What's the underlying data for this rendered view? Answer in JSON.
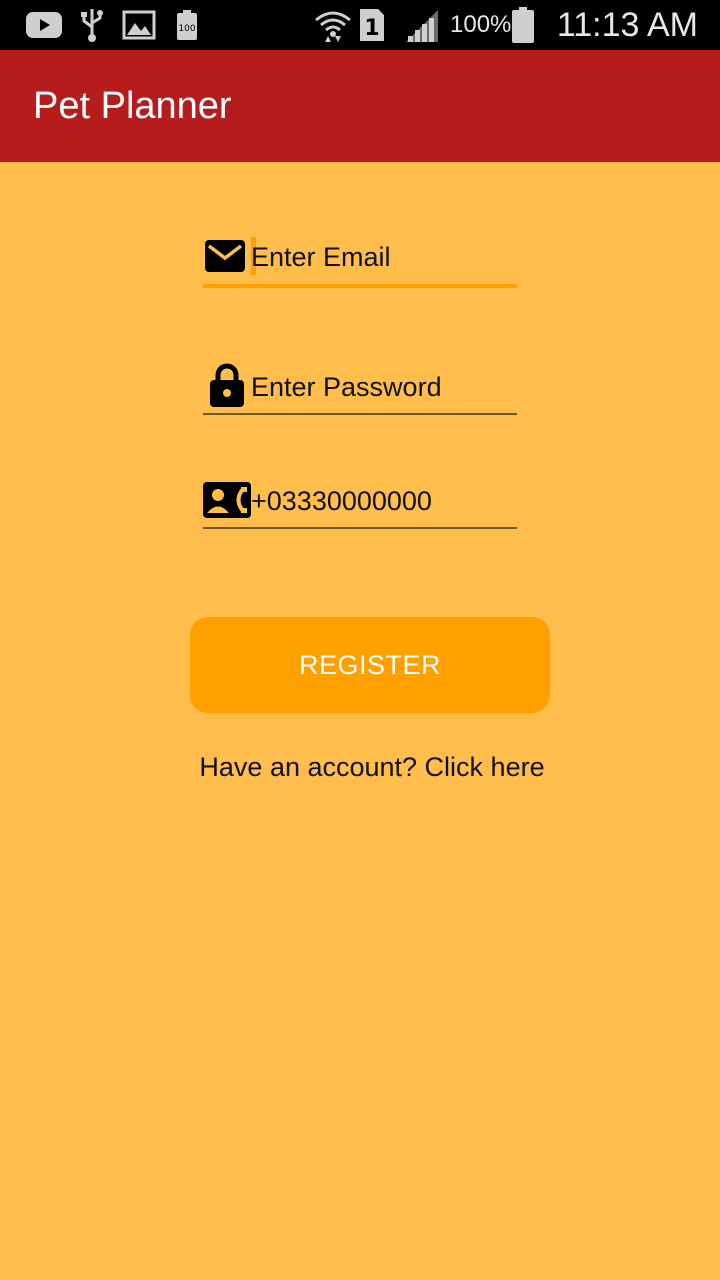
{
  "status_bar": {
    "time": "11:13 AM",
    "battery_percent": "100%",
    "sim_slot": "1",
    "notification_battery_label": "100",
    "icons": [
      "youtube-icon",
      "usb-icon",
      "gallery-icon",
      "battery-notify-icon",
      "wifi-icon",
      "sim-icon",
      "signal-icon",
      "battery-icon"
    ]
  },
  "app_bar": {
    "title": "Pet Planner",
    "color": "#B71C1C"
  },
  "form": {
    "email": {
      "placeholder": "Enter Email",
      "value": "",
      "icon": "email-icon"
    },
    "password": {
      "placeholder": "Enter Password",
      "value": "",
      "icon": "lock-icon"
    },
    "phone": {
      "placeholder": "",
      "value": "+03330000000",
      "icon": "contact-phone-icon"
    }
  },
  "register_button": {
    "label": "REGISTER",
    "color": "#FFA000"
  },
  "login_link": {
    "label": "Have an account? Click here"
  },
  "colors": {
    "background": "#FFBE4B",
    "accent": "#FFA000"
  }
}
